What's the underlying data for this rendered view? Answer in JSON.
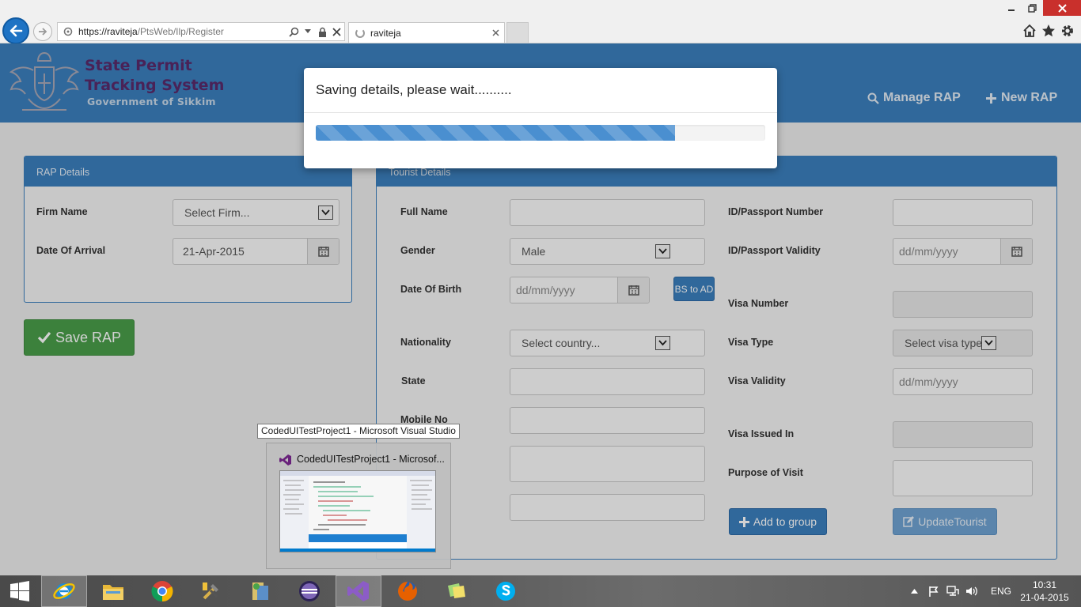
{
  "browser": {
    "url_host": "https://raviteja",
    "url_path": "/PtsWeb/Ilp/Register",
    "tab_title": "raviteja"
  },
  "header": {
    "title_line1": "State Permit",
    "title_line2": "Tracking System",
    "subtitle": "Government of Sikkim",
    "nav": {
      "manage": "Manage RAP",
      "new": "New RAP"
    }
  },
  "rap_panel": {
    "title": "RAP Details",
    "firm_label": "Firm Name",
    "firm_value": "Select Firm...",
    "arrival_label": "Date Of Arrival",
    "arrival_value": "21-Apr-2015",
    "save_label": "Save RAP"
  },
  "tourist_panel": {
    "title": "Tourist Details",
    "full_name_label": "Full Name",
    "gender_label": "Gender",
    "gender_value": "Male",
    "dob_label": "Date Of Birth",
    "dob_placeholder": "dd/mm/yyyy",
    "bs_to_ad_label": "BS to AD",
    "nationality_label": "Nationality",
    "nationality_value": "Select country...",
    "state_label": "State",
    "mobile_label": "Mobile No",
    "id_number_label": "ID/Passport Number",
    "id_validity_label": "ID/Passport Validity",
    "id_validity_placeholder": "dd/mm/yyyy",
    "visa_number_label": "Visa Number",
    "visa_type_label": "Visa Type",
    "visa_type_value": "Select visa type",
    "visa_validity_label": "Visa Validity",
    "visa_validity_placeholder": "dd/mm/yyyy",
    "visa_issued_label": "Visa Issued In",
    "purpose_label": "Purpose of Visit",
    "add_group_label": "Add to group",
    "update_label": "UpdateTourist"
  },
  "modal": {
    "message": "Saving details, please wait..........",
    "progress_fraction": 0.8
  },
  "taskbar": {
    "tooltip": "CodedUITestProject1 - Microsoft Visual Studio",
    "thumb_title": "CodedUITestProject1 - Microsof...",
    "language": "ENG",
    "time": "10:31",
    "date": "21-04-2015"
  },
  "colors": {
    "brand_blue": "#3b7fbe",
    "save_green": "#4a9e4a",
    "title_purple": "#5a2a6b"
  }
}
